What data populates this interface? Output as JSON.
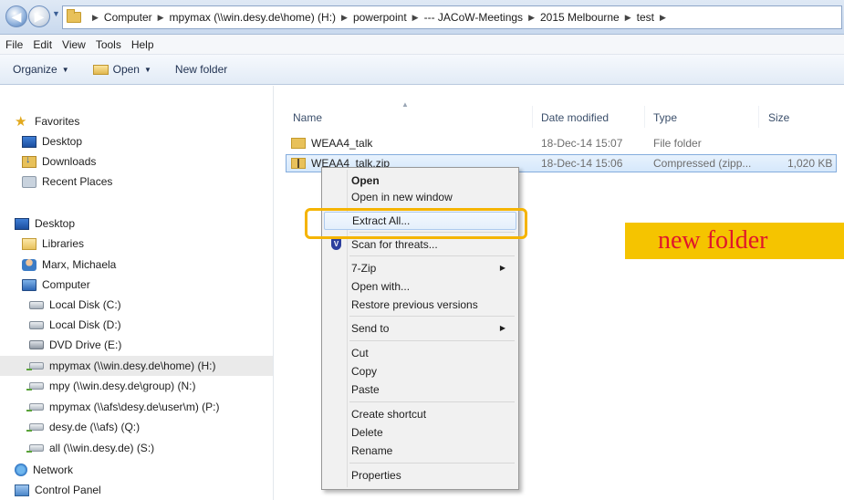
{
  "address": {
    "crumbs": [
      "Computer",
      "mpymax (\\\\win.desy.de\\home) (H:)",
      "powerpoint",
      "--- JACoW-Meetings",
      "2015 Melbourne",
      "test"
    ]
  },
  "menubar": {
    "items": [
      "File",
      "Edit",
      "View",
      "Tools",
      "Help"
    ]
  },
  "toolbar": {
    "organize": "Organize",
    "open": "Open",
    "new_folder": "New folder"
  },
  "navpane": {
    "favorites": "Favorites",
    "desktop_fav": "Desktop",
    "downloads": "Downloads",
    "recent": "Recent Places",
    "desktop": "Desktop",
    "libraries": "Libraries",
    "user": "Marx, Michaela",
    "computer": "Computer",
    "local_c": "Local Disk (C:)",
    "local_d": "Local Disk (D:)",
    "dvd": "DVD Drive (E:)",
    "drive_h": "mpymax (\\\\win.desy.de\\home) (H:)",
    "drive_n": "mpy (\\\\win.desy.de\\group) (N:)",
    "drive_p": "mpymax (\\\\afs\\desy.de\\user\\m) (P:)",
    "drive_q": "desy.de (\\\\afs) (Q:)",
    "drive_s": "all (\\\\win.desy.de) (S:)",
    "network": "Network",
    "control_panel": "Control Panel"
  },
  "columns": {
    "name": "Name",
    "date": "Date modified",
    "type": "Type",
    "size": "Size"
  },
  "files": [
    {
      "name": "WEAA4_talk",
      "date": "18-Dec-14 15:07",
      "type": "File folder",
      "size": ""
    },
    {
      "name": "WEAA4_talk.zip",
      "date": "18-Dec-14 15:06",
      "type": "Compressed (zipp...",
      "size": "1,020 KB"
    }
  ],
  "context_menu": {
    "open": "Open",
    "open_new_window": "Open in new window",
    "extract_all": "Extract All...",
    "scan": "Scan for threats...",
    "sevenzip": "7-Zip",
    "open_with": "Open with...",
    "restore": "Restore previous versions",
    "send_to": "Send to",
    "cut": "Cut",
    "copy": "Copy",
    "paste": "Paste",
    "create_shortcut": "Create shortcut",
    "delete": "Delete",
    "rename": "Rename",
    "properties": "Properties"
  },
  "annotation": {
    "text": "new folder"
  },
  "colors": {
    "highlight_box": "#f5b400",
    "annotation_bg": "#f5c400",
    "annotation_text": "#e0162b"
  }
}
